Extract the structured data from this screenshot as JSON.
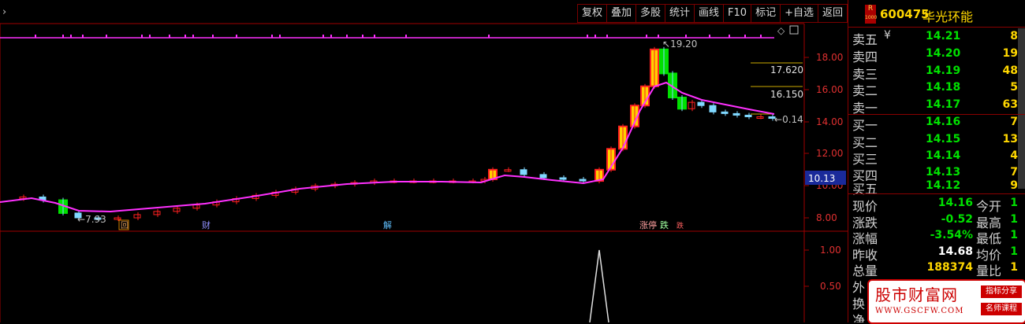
{
  "toolbar": {
    "items": [
      "复权",
      "叠加",
      "多股",
      "统计",
      "画线",
      "F10",
      "标记",
      "+自选",
      "返回"
    ]
  },
  "stock": {
    "code": "600475",
    "name": "华光环能",
    "badge_top": "R",
    "badge_bottom": "1000"
  },
  "orderbook": {
    "sell": [
      {
        "label": "卖五",
        "mark": "¥",
        "price": "14.21",
        "vol": "8"
      },
      {
        "label": "卖四",
        "mark": "",
        "price": "14.20",
        "vol": "19"
      },
      {
        "label": "卖三",
        "mark": "",
        "price": "14.19",
        "vol": "48"
      },
      {
        "label": "卖二",
        "mark": "",
        "price": "14.18",
        "vol": "5"
      },
      {
        "label": "卖一",
        "mark": "",
        "price": "14.17",
        "vol": "63"
      }
    ],
    "buy": [
      {
        "label": "买一",
        "price": "14.16",
        "vol": "7"
      },
      {
        "label": "买二",
        "price": "14.15",
        "vol": "13"
      },
      {
        "label": "买三",
        "price": "14.14",
        "vol": "4"
      },
      {
        "label": "买四",
        "price": "14.13",
        "vol": "7"
      },
      {
        "label": "买五",
        "price": "14.12",
        "vol": "9"
      }
    ]
  },
  "stats": [
    {
      "l1": "现价",
      "v1": "14.16",
      "c1": "#00e000",
      "l2": "今开",
      "v2": "1"
    },
    {
      "l1": "涨跌",
      "v1": "-0.52",
      "c1": "#00e000",
      "l2": "最高",
      "v2": "1"
    },
    {
      "l1": "涨幅",
      "v1": "-3.54%",
      "c1": "#00e000",
      "l2": "最低",
      "v2": "1"
    },
    {
      "l1": "昨收",
      "v1": "14.68",
      "c1": "#ffffff",
      "l2": "均价",
      "v2": "1"
    },
    {
      "l1": "总量",
      "v1": "188374",
      "c1": "#ffd700",
      "l2": "量比",
      "v2": "1"
    },
    {
      "l1": "外",
      "v1": "",
      "c1": "#ffd700",
      "l2": "",
      "v2": ""
    },
    {
      "l1": "换",
      "v1": "",
      "c1": "#ffd700",
      "l2": "",
      "v2": ""
    },
    {
      "l1": "净",
      "v1": "",
      "c1": "#ffd700",
      "l2": "",
      "v2": ""
    }
  ],
  "chart_data": {
    "type": "candlestick",
    "price_axis": [
      "18.00",
      "16.00",
      "14.00",
      "12.00",
      "10.00",
      "8.00"
    ],
    "current_price_tag": "10.13",
    "annotations": {
      "high": "19.20",
      "low": "7.93",
      "last": "0.14",
      "level1": "17.620",
      "level2": "16.150"
    },
    "event_marks": [
      "回",
      "财",
      "解",
      "涨停",
      "跌",
      "跌"
    ],
    "indicator_axis": [
      "1.00",
      "0.50"
    ]
  },
  "colors": {
    "up": "#ff2020",
    "down": "#00e000",
    "ma": "#ff30ff",
    "axis": "#a00000"
  },
  "watermark": {
    "title": "股市财富网",
    "url": "WWW.GSCFW.COM",
    "tag1": "指标分享",
    "tag2": "名师课程"
  }
}
